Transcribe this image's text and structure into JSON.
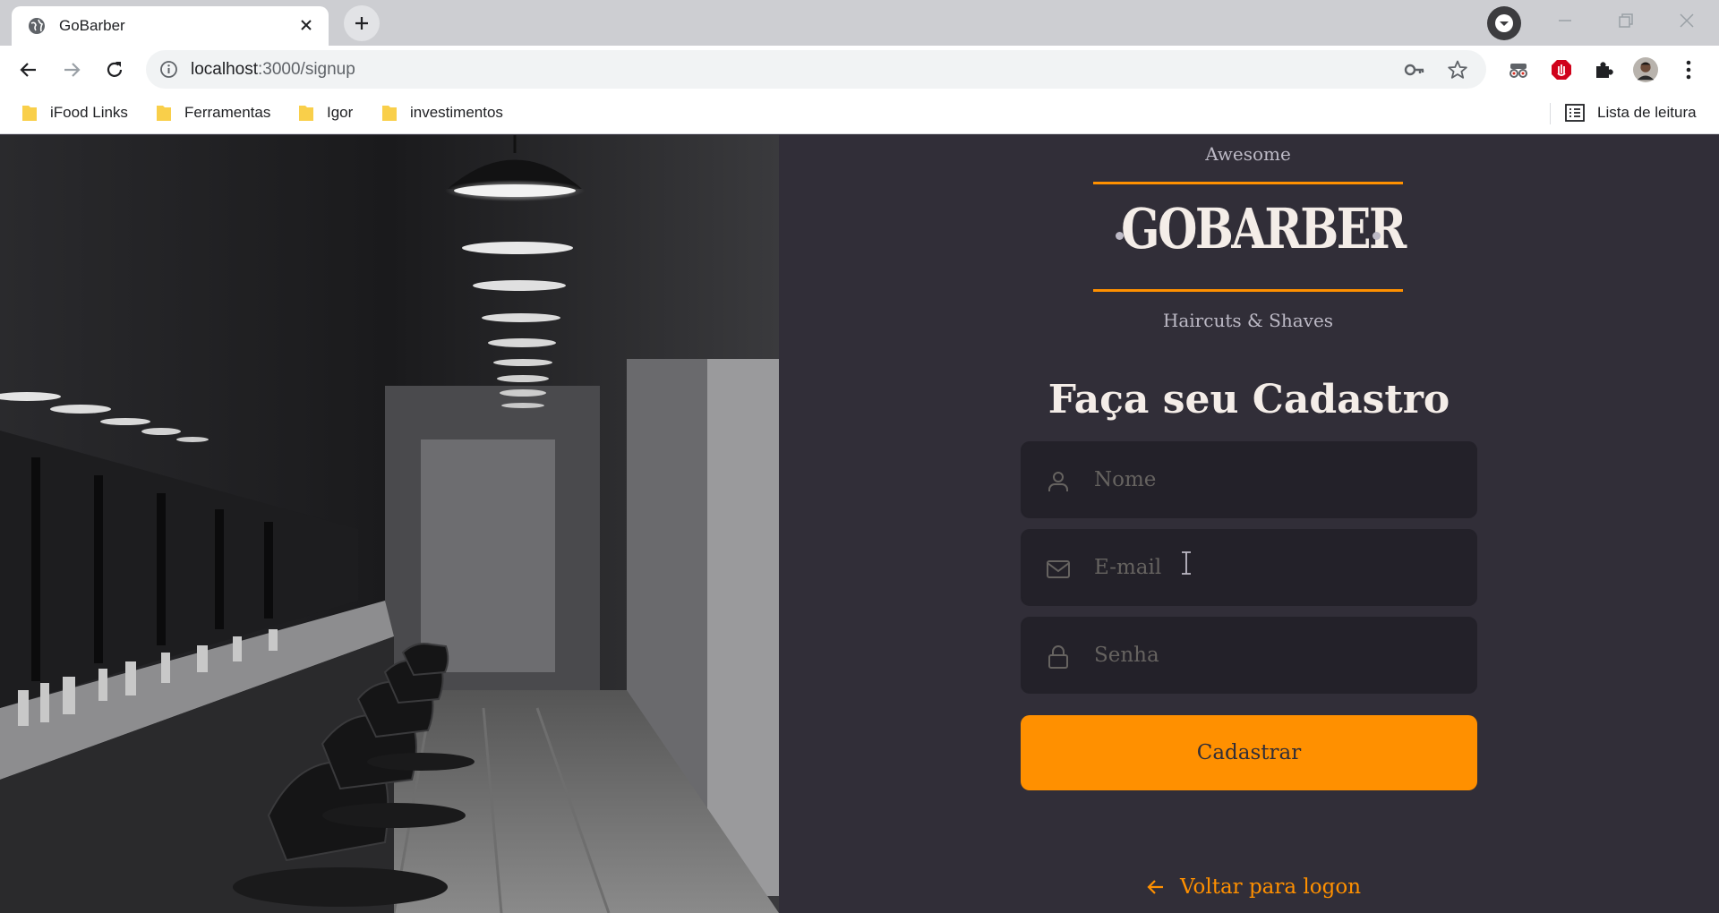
{
  "browser": {
    "tab": {
      "title": "GoBarber"
    },
    "address": {
      "host": "localhost",
      "path": ":3000/signup"
    },
    "bookmarks": [
      {
        "label": "iFood Links"
      },
      {
        "label": "Ferramentas"
      },
      {
        "label": "Igor"
      },
      {
        "label": "investimentos"
      }
    ],
    "reading_list": "Lista de leitura"
  },
  "logo": {
    "top_text": "Awesome",
    "brand": "GOBARBER",
    "tagline": "Haircuts & Shaves",
    "accent": "#ff9000"
  },
  "form": {
    "title": "Faça seu Cadastro",
    "fields": [
      {
        "placeholder": "Nome",
        "icon": "user-icon",
        "value": ""
      },
      {
        "placeholder": "E-mail",
        "icon": "mail-icon",
        "value": ""
      },
      {
        "placeholder": "Senha",
        "icon": "lock-icon",
        "value": ""
      }
    ],
    "submit_label": "Cadastrar",
    "back_label": "Voltar para logon"
  },
  "colors": {
    "background": "#312e38",
    "input_background": "#232129",
    "placeholder": "#666360",
    "text": "#f4ede8",
    "primary": "#ff9000"
  }
}
